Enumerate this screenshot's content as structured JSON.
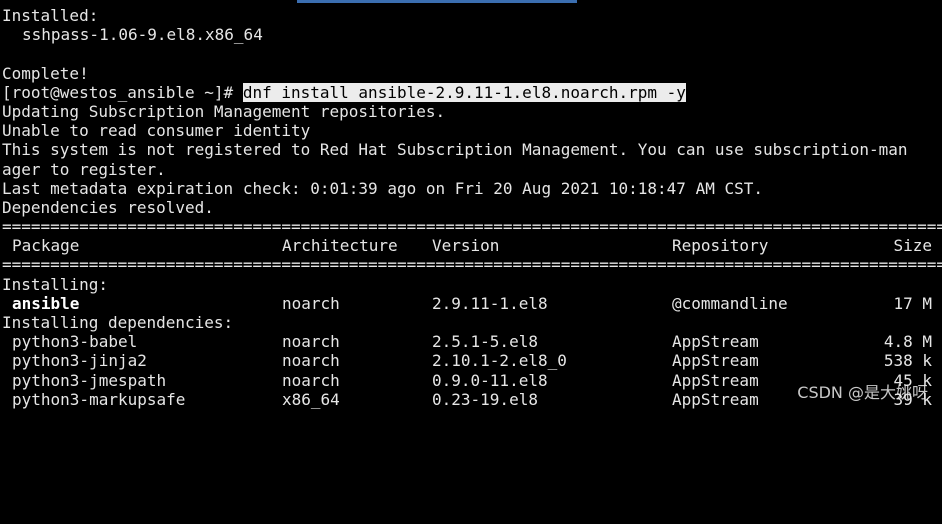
{
  "terminal": {
    "lines": {
      "installed_header": "Installed:",
      "installed_pkg": "sshpass-1.06-9.el8.x86_64",
      "complete": "Complete!",
      "prompt": "[root@westos_ansible ~]# ",
      "command": "dnf install ansible-2.9.11-1.el8.noarch.rpm -y",
      "updating": "Updating Subscription Management repositories.",
      "unable": "Unable to read consumer identity",
      "not_registered_1": "This system is not registered to Red Hat Subscription Management. You can use subscription-man",
      "not_registered_2": "ager to register.",
      "metadata": "Last metadata expiration check: 0:01:39 ago on Fri 20 Aug 2021 10:18:47 AM CST.",
      "deps_resolved": "Dependencies resolved.",
      "rule": "================================================================================================================================================"
    },
    "table": {
      "headers": {
        "package": "Package",
        "architecture": "Architecture",
        "version": "Version",
        "repository": "Repository",
        "size": "Size"
      },
      "section_installing": "Installing:",
      "section_deps": "Installing dependencies:",
      "installing": [
        {
          "package": "ansible",
          "arch": "noarch",
          "version": "2.9.11-1.el8",
          "repo": "@commandline",
          "size": "17 M"
        }
      ],
      "dependencies": [
        {
          "package": "python3-babel",
          "arch": "noarch",
          "version": "2.5.1-5.el8",
          "repo": "AppStream",
          "size": "4.8 M"
        },
        {
          "package": "python3-jinja2",
          "arch": "noarch",
          "version": "2.10.1-2.el8_0",
          "repo": "AppStream",
          "size": "538 k"
        },
        {
          "package": "python3-jmespath",
          "arch": "noarch",
          "version": "0.9.0-11.el8",
          "repo": "AppStream",
          "size": "45 k"
        },
        {
          "package": "python3-markupsafe",
          "arch": "x86_64",
          "version": "0.23-19.el8",
          "repo": "AppStream",
          "size": "39 k"
        }
      ]
    }
  },
  "watermark": "CSDN @是大姚呀",
  "colors": {
    "background": "#000000",
    "text": "#e6e6e6",
    "highlight": "#ececec",
    "tab_indicator": "#3b6eb0"
  }
}
